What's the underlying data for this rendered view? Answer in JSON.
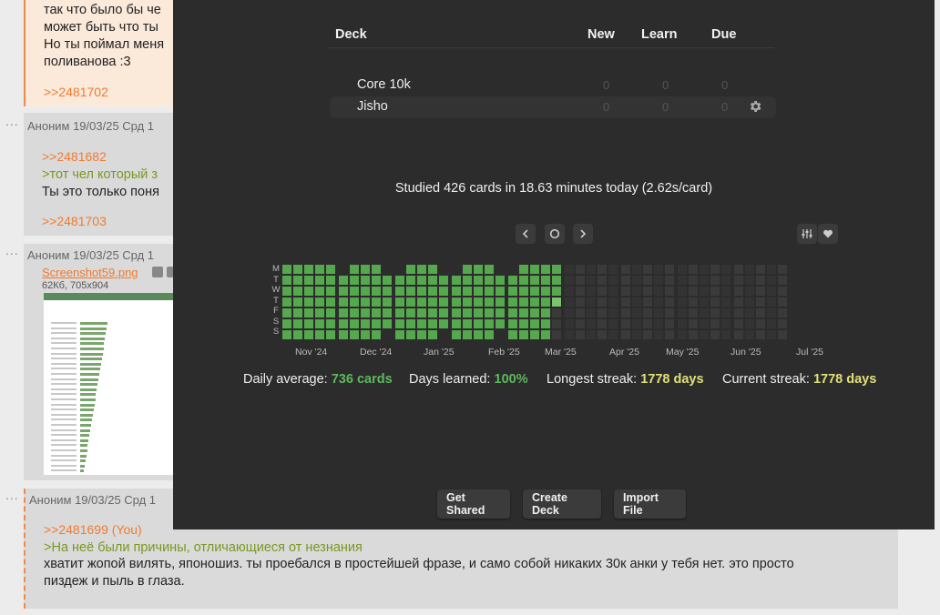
{
  "forum": {
    "post1": {
      "lines": [
        "так что было бы че",
        "может быть что ты",
        "Но ты поймал меня",
        "поливанова :3"
      ],
      "reply_ref": ">>2481702"
    },
    "post2": {
      "header": "Аноним 19/03/25 Срд 1",
      "quote_ref": ">>2481682",
      "greentext": ">тот чел который з",
      "text": "Ты это только поня",
      "reply_ref": ">>2481703"
    },
    "post3": {
      "header": "Аноним 19/03/25 Срд 1",
      "file_name": "Screenshot59.png",
      "file_meta": "62Кб, 705x904"
    },
    "post4": {
      "header": "Аноним 19/03/25 Срд 1",
      "quote_ref": ">>2481699 (You)",
      "greentext": ">На неё были причины, отличающиеся от незнания",
      "text_line1": "хватит жопой вилять, японошиз. ты проебался в простейшей фразе, и само собой никаких 30к анки у тебя нет. это просто",
      "text_line2": "пиздеж и пыль в глаза."
    },
    "dots": "..."
  },
  "anki": {
    "columns": {
      "deck": "Deck",
      "new": "New",
      "learn": "Learn",
      "due": "Due"
    },
    "decks": [
      {
        "name": "Core 10k",
        "new": "0",
        "learn": "0",
        "due": "0"
      },
      {
        "name": "Jisho",
        "new": "0",
        "learn": "0",
        "due": "0"
      }
    ],
    "studied_today": "Studied 426 cards in 18.63 minutes today (2.62s/card)",
    "heatmap": {
      "weekdays": [
        "M",
        "T",
        "W",
        "T",
        "F",
        "S",
        "S"
      ],
      "months": [
        "Nov '24",
        "Dec '24",
        "Jan '25",
        "Feb '25",
        "Mar '25",
        "Apr '25",
        "May '25",
        "Jun '25",
        "Jul '25"
      ],
      "colors": {
        "active": "#55a84e",
        "active_light": "#7cc36c",
        "future": "#3a3a3a",
        "empty": "#333333"
      }
    },
    "stats": {
      "daily_average_label": "Daily average:",
      "daily_average_value": "736 cards",
      "days_learned_label": "Days learned:",
      "days_learned_value": "100%",
      "longest_streak_label": "Longest streak:",
      "longest_streak_value": "1778 days",
      "current_streak_label": "Current streak:",
      "current_streak_value": "1778 days"
    },
    "buttons": {
      "get_shared": "Get Shared",
      "create_deck": "Create Deck",
      "import_file": "Import File"
    },
    "icons": {
      "prev": "chevron-left-icon",
      "today": "circle-icon",
      "next": "chevron-right-icon",
      "options": "sliders-icon",
      "heart": "heart-icon",
      "gear": "gear-icon"
    }
  }
}
